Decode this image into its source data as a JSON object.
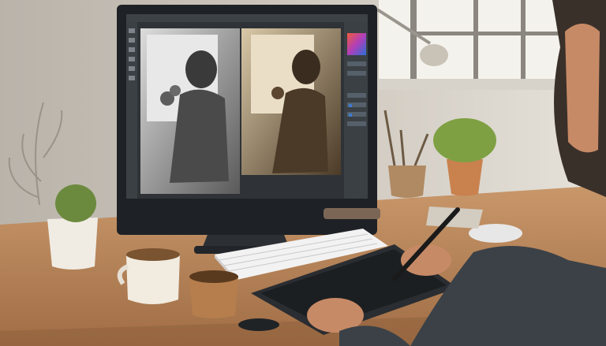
{
  "scene": {
    "description_hidden": "",
    "palette": {
      "wall": "#c9c3b9",
      "window_light": "#f1efe9",
      "desk": "#b88658",
      "desk_dark": "#8e5f3b",
      "monitor_frame": "#1e2226",
      "app_bg": "#2f3337",
      "panel_bg": "#3b4045",
      "swatch_accent": "#e35a3a"
    }
  }
}
